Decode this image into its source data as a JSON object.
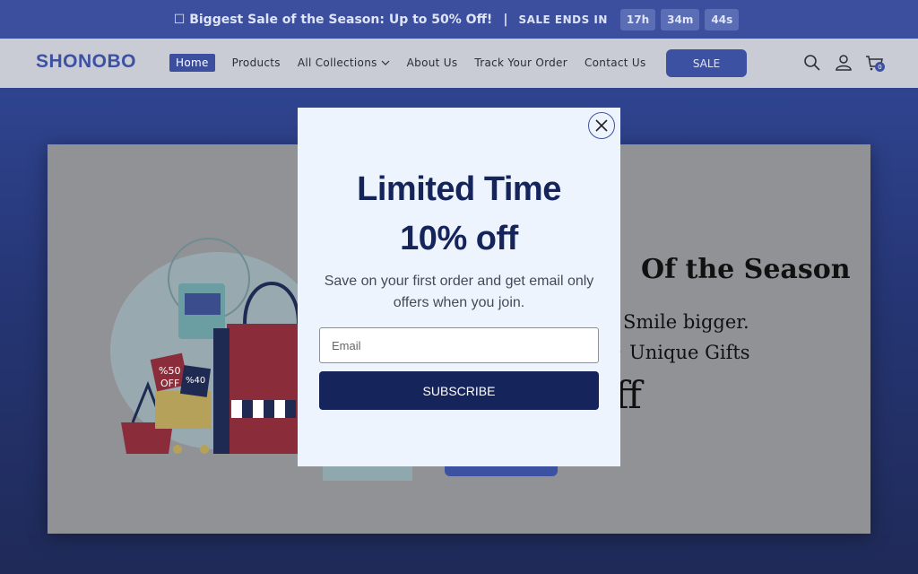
{
  "announcement": {
    "text": "☐ Biggest Sale of the Season: Up to 50% Off!",
    "separator": "|",
    "ends_label": "SALE ENDS IN",
    "timer": [
      "17h",
      "34m",
      "44s"
    ]
  },
  "header": {
    "logo": "SHONOBO",
    "nav": [
      "Home",
      "Products",
      "All Collections",
      "About Us",
      "Track Your Order",
      "Contact Us"
    ],
    "sale_label": "SALE",
    "cart_count": "0"
  },
  "banner": {
    "headline": "Of the Season",
    "line1": "Smile bigger.",
    "line2": "• Unique Gifts",
    "partial": "ff",
    "tags": [
      "%50",
      "OFF",
      "%40"
    ]
  },
  "modal": {
    "title_line1": "Limited Time",
    "title_line2": "10% off",
    "subtitle": "Save on your first order and get email only offers when you join.",
    "email_placeholder": "Email",
    "subscribe_label": "SUBSCRIBE"
  },
  "colors": {
    "brand": "#3d51a3",
    "announce_bg": "#3b4f9e",
    "modal_dark": "#15255c",
    "modal_bg": "#eef4fe"
  }
}
